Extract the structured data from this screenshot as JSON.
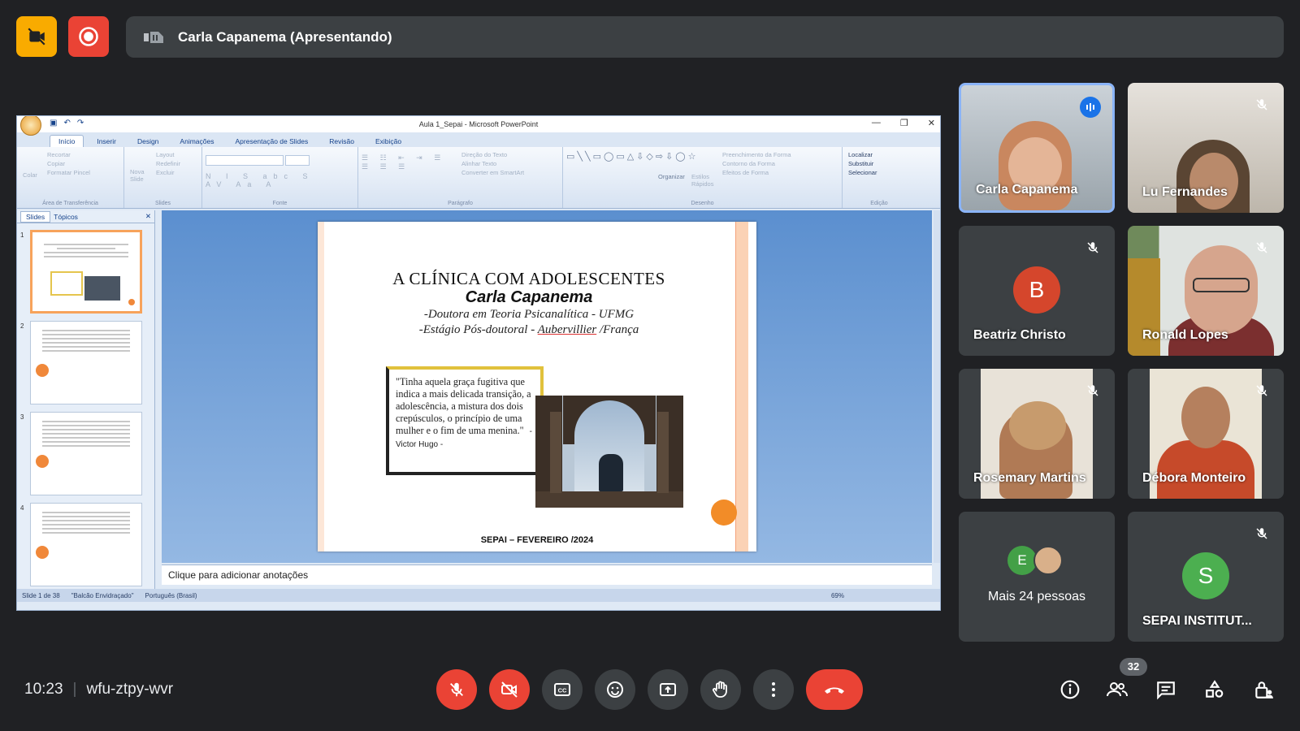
{
  "presenter_bar": {
    "label": "Carla Capanema (Apresentando)"
  },
  "ppt": {
    "window_title": "Aula 1_Sepai - Microsoft PowerPoint",
    "tabs": [
      "Início",
      "Inserir",
      "Design",
      "Animações",
      "Apresentação de Slides",
      "Revisão",
      "Exibição"
    ],
    "ribbon_groups": {
      "clipboard": {
        "label": "Área de Transferência",
        "items": [
          "Colar",
          "Recortar",
          "Copiar",
          "Formatar Pincel"
        ]
      },
      "slides": {
        "label": "Slides",
        "items": [
          "Nova Slide",
          "Layout",
          "Redefinir",
          "Excluir"
        ]
      },
      "font": {
        "label": "Fonte"
      },
      "paragraph": {
        "label": "Parágrafo",
        "items": [
          "Direção do Texto",
          "Alinhar Texto",
          "Converter em SmartArt"
        ]
      },
      "drawing": {
        "label": "Desenho",
        "items": [
          "Organizar",
          "Estilos Rápidos",
          "Preenchimento da Forma",
          "Contorno da Forma",
          "Efeitos de Forma"
        ]
      },
      "editing": {
        "label": "Edição",
        "items": [
          "Localizar",
          "Substituir",
          "Selecionar"
        ]
      }
    },
    "panel_tabs": [
      "Slides",
      "Tópicos"
    ],
    "slide_numbers": [
      "1",
      "2",
      "3",
      "4"
    ],
    "slide": {
      "title": "A CLÍNICA COM ADOLESCENTES",
      "author": "Carla Capanema",
      "line1": "-Doutora em Teoria Psicanalítica - UFMG",
      "line2_pre": "-Estágio Pós-doutoral - ",
      "line2_link": "Aubervillier",
      "line2_post": " /França",
      "quote": "\"Tinha aquela graça fugitiva que indica a mais delicada transição, a adolescência, a mistura dos dois crepúsculos, o princípio de uma mulher e o fim de uma menina.\"",
      "quote_author": "- Victor Hugo -",
      "footer": "SEPAI – FEVEREIRO /2024"
    },
    "notes_placeholder": "Clique para adicionar anotações",
    "status": {
      "slide_count": "Slide 1 de 38",
      "theme": "\"Balcão Envidraçado\"",
      "language": "Português (Brasil)",
      "zoom": "69%"
    }
  },
  "participants": [
    {
      "name": "Carla Capanema",
      "state": "speaking"
    },
    {
      "name": "Lu Fernandes",
      "state": "muted"
    },
    {
      "name": "Beatriz Christo",
      "initial": "B",
      "color": "#d5462c",
      "state": "muted"
    },
    {
      "name": "Ronald Lopes",
      "state": "muted"
    },
    {
      "name": "Rosemary Martins",
      "state": "muted"
    },
    {
      "name": "Débora Monteiro",
      "state": "muted"
    },
    {
      "name": "Mais 24 pessoas",
      "initial": "E",
      "color": "#43a047"
    },
    {
      "name": "SEPAI INSTITUT...",
      "initial": "S",
      "color": "#4caf50",
      "state": "muted"
    }
  ],
  "meeting": {
    "time": "10:23",
    "code": "wfu-ztpy-wvr",
    "people_count": "32"
  },
  "colors": {
    "bg": "#202124",
    "tile": "#3c4043",
    "danger": "#ea4335",
    "accent_yellow": "#f9ab00",
    "speaking": "#8ab4f8"
  }
}
